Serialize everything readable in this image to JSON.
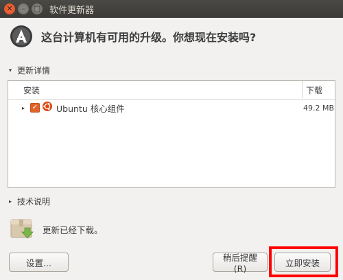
{
  "window": {
    "title": "软件更新器"
  },
  "header": {
    "message": "这台计算机有可用的升级。你想现在安装吗?"
  },
  "details_expander": {
    "label": "更新详情"
  },
  "table": {
    "col_install": "安装",
    "col_size": "下载",
    "rows": [
      {
        "name": "Ubuntu 核心组件",
        "size": "49.2 MB",
        "checked": true
      }
    ]
  },
  "tech_expander": {
    "label": "技术说明"
  },
  "status": {
    "text": "更新已经下载。"
  },
  "buttons": {
    "settings": "设置...",
    "remind_later": "稍后提醒(R)",
    "install_now": "立即安装"
  },
  "colors": {
    "accent": "#e0652b",
    "highlight": "#ff0000"
  }
}
